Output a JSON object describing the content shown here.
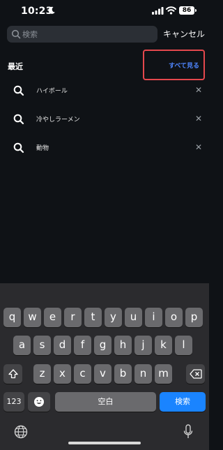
{
  "status_bar": {
    "time": "10:23",
    "battery": "86"
  },
  "search": {
    "placeholder": "検索",
    "cancel_label": "キャンセル"
  },
  "recents": {
    "title": "最近",
    "see_all": "すべて見る",
    "items": [
      {
        "label": "ハイボール"
      },
      {
        "label": "冷やしラーメン"
      },
      {
        "label": "動物"
      }
    ]
  },
  "keyboard": {
    "row1": [
      "q",
      "w",
      "e",
      "r",
      "t",
      "y",
      "u",
      "i",
      "o",
      "p"
    ],
    "row2": [
      "a",
      "s",
      "d",
      "f",
      "g",
      "h",
      "j",
      "k",
      "l"
    ],
    "row3": [
      "z",
      "x",
      "c",
      "v",
      "b",
      "n",
      "m"
    ],
    "numbers_label": "123",
    "space_label": "空白",
    "search_label": "検索"
  },
  "colors": {
    "accent": "#4f86ff",
    "highlight": "#e5484d",
    "key_blue": "#1a84ff"
  },
  "icons": [
    "moon-icon",
    "signal-icon",
    "wifi-icon",
    "search-icon",
    "close-icon",
    "shift-icon",
    "backspace-icon",
    "emoji-icon",
    "globe-icon",
    "mic-icon"
  ]
}
